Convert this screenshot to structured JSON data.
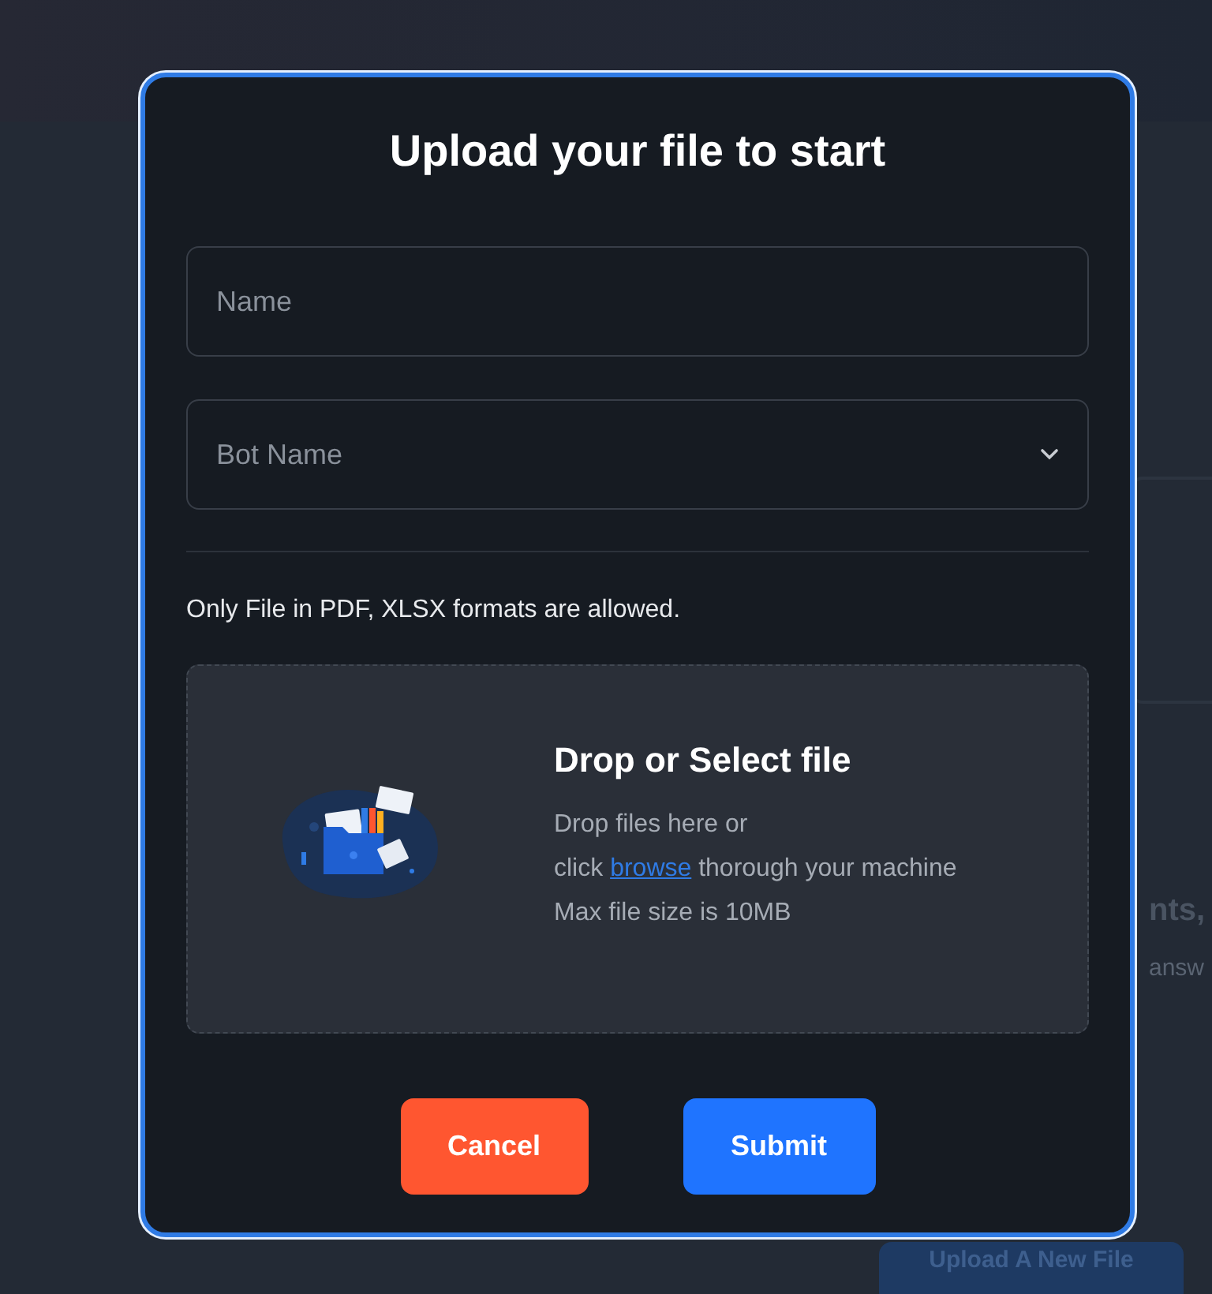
{
  "background": {
    "heading_fragment": "nts,",
    "text_fragment": "answ",
    "button": "Upload A New File"
  },
  "dialog": {
    "title": "Upload your file to start",
    "fields": [
      {
        "kind": "text",
        "placeholder": "Name"
      },
      {
        "kind": "select",
        "placeholder": "Bot Name"
      }
    ],
    "hint": "Only File in PDF, XLSX formats are allowed.",
    "dropzone": {
      "title": "Drop or Select file",
      "line_1": "Drop files here or",
      "line_2_before": "click",
      "link": "browse",
      "line_2_after": "thorough your machine",
      "line_3": "Max file size is 10MB"
    },
    "buttons": [
      {
        "kind": "cancel",
        "label": "Cancel"
      },
      {
        "kind": "submit",
        "label": "Submit"
      }
    ]
  }
}
